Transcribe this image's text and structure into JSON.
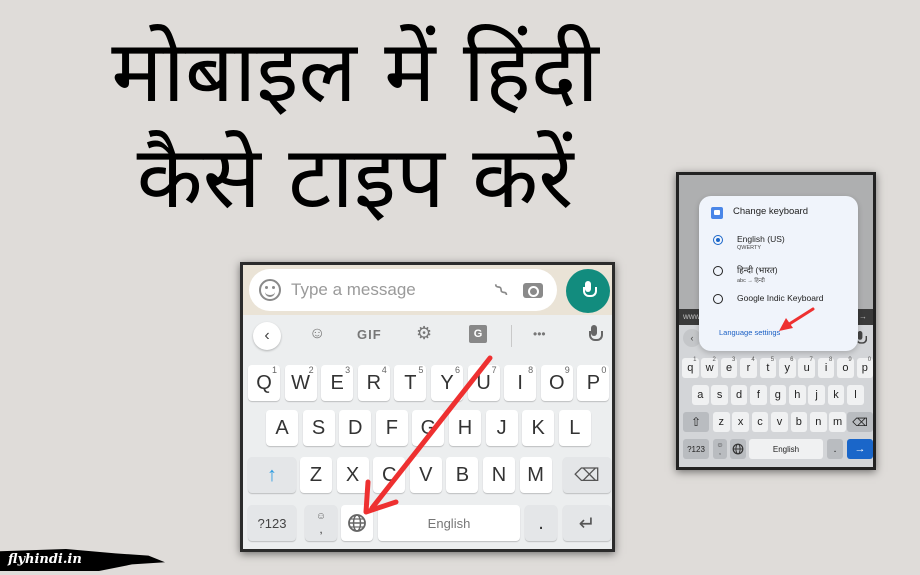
{
  "headline": {
    "line1": "मोबाइल में हिंदी",
    "line2": "कैसे टाइप करें"
  },
  "left_keyboard": {
    "message_placeholder": "Type a message",
    "icons": {
      "emoji": "emoji-icon",
      "attach": "paperclip-icon",
      "camera": "camera-icon",
      "mic": "mic-icon"
    },
    "toolbar": {
      "back": "‹",
      "sticker": "☺",
      "gif": "GIF",
      "settings": "⚙",
      "translate": "G",
      "more": "•••",
      "voice": "mic-icon"
    },
    "rows": [
      [
        {
          "k": "Q",
          "n": "1"
        },
        {
          "k": "W",
          "n": "2"
        },
        {
          "k": "E",
          "n": "3"
        },
        {
          "k": "R",
          "n": "4"
        },
        {
          "k": "T",
          "n": "5"
        },
        {
          "k": "Y",
          "n": "6"
        },
        {
          "k": "U",
          "n": "7"
        },
        {
          "k": "I",
          "n": "8"
        },
        {
          "k": "O",
          "n": "9"
        },
        {
          "k": "P",
          "n": "0"
        }
      ],
      [
        {
          "k": "A"
        },
        {
          "k": "S"
        },
        {
          "k": "D"
        },
        {
          "k": "F"
        },
        {
          "k": "G"
        },
        {
          "k": "H"
        },
        {
          "k": "J"
        },
        {
          "k": "K"
        },
        {
          "k": "L"
        }
      ],
      [
        {
          "k": "Z"
        },
        {
          "k": "X"
        },
        {
          "k": "C"
        },
        {
          "k": "V"
        },
        {
          "k": "B"
        },
        {
          "k": "N"
        },
        {
          "k": "M"
        }
      ]
    ],
    "shift": "↑",
    "backspace": "⌫",
    "symbols": "?123",
    "emoji_comma": ",",
    "globe": "🌐",
    "space": "English",
    "period": ".",
    "enter": "↵",
    "accent_color": "#128c7e",
    "shift_color": "#2d9be0"
  },
  "right_phone": {
    "dialog_title": "Change keyboard",
    "options": [
      {
        "label": "English (US)",
        "sub": "QWERTY",
        "selected": true
      },
      {
        "label": "हिन्दी (भारत)",
        "sub": "abc → हिन्दी",
        "selected": false
      },
      {
        "label": "Google Indic Keyboard",
        "sub": "",
        "selected": false
      }
    ],
    "language_settings": "Language settings",
    "url_fragment": "www",
    "url_arrow": "→",
    "rows": [
      [
        {
          "k": "q",
          "n": "1"
        },
        {
          "k": "w",
          "n": "2"
        },
        {
          "k": "e",
          "n": "3"
        },
        {
          "k": "r",
          "n": "4"
        },
        {
          "k": "t",
          "n": "5"
        },
        {
          "k": "y",
          "n": "6"
        },
        {
          "k": "u",
          "n": "7"
        },
        {
          "k": "i",
          "n": "8"
        },
        {
          "k": "o",
          "n": "9"
        },
        {
          "k": "p",
          "n": "0"
        }
      ],
      [
        {
          "k": "a"
        },
        {
          "k": "s"
        },
        {
          "k": "d"
        },
        {
          "k": "f"
        },
        {
          "k": "g"
        },
        {
          "k": "h"
        },
        {
          "k": "j"
        },
        {
          "k": "k"
        },
        {
          "k": "l"
        }
      ],
      [
        {
          "k": "z"
        },
        {
          "k": "x"
        },
        {
          "k": "c"
        },
        {
          "k": "v"
        },
        {
          "k": "b"
        },
        {
          "k": "n"
        },
        {
          "k": "m"
        }
      ]
    ],
    "shift": "⇧",
    "backspace": "⌫",
    "symbols": "?123",
    "emoji_comma": ",",
    "globe": "🌐",
    "space": "English",
    "period": ".",
    "enter": "→",
    "accent_color": "#1a66c9"
  },
  "arrows_color": "#ee3030",
  "brand": "flyhindi.in"
}
